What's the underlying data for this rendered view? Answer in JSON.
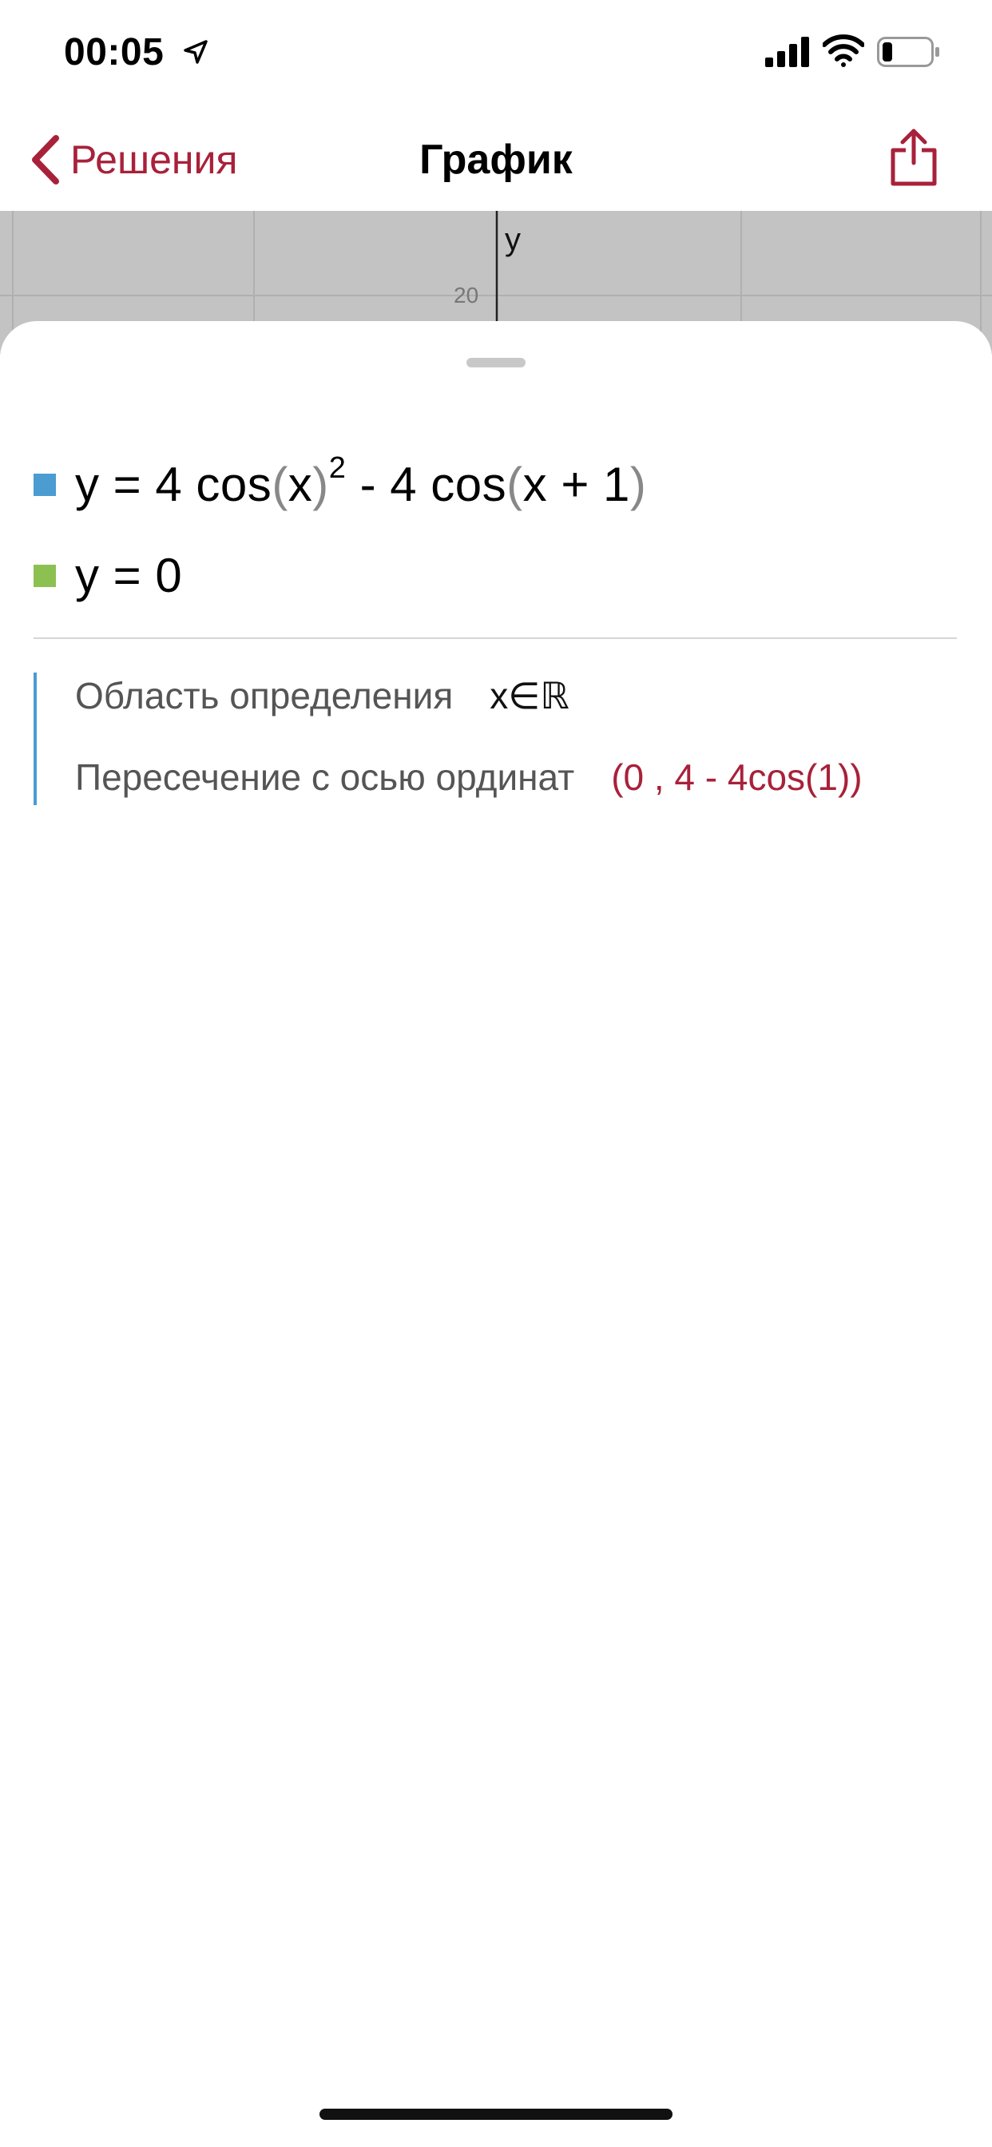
{
  "status_bar": {
    "time": "00:05",
    "icons": [
      "location-arrow-icon",
      "cellular-signal-icon",
      "wifi-icon",
      "battery-icon"
    ]
  },
  "nav": {
    "back_label": "Решения",
    "title": "График",
    "share_icon": "share-icon",
    "accent_color": "#a8213a"
  },
  "graph": {
    "axis_label": "y",
    "tick_label": "20"
  },
  "equations": [
    {
      "color": "#4a9cd1",
      "parts": {
        "lhs": "y",
        "eq": "=",
        "a": "4 cos",
        "p1_open": "(",
        "p1_arg": "x",
        "p1_close": ")",
        "exp": "2",
        "op": "-",
        "b": "4 cos",
        "p2_open": "(",
        "p2_arg": "x + 1",
        "p2_close": ")"
      }
    },
    {
      "color": "#8cc152",
      "text": "y = 0"
    }
  ],
  "properties": [
    {
      "label": "Область определения",
      "value": "x∈ℝ"
    },
    {
      "label": "Пересечение с осью ординат",
      "value": "(0 , 4 - 4cos(1))"
    }
  ]
}
